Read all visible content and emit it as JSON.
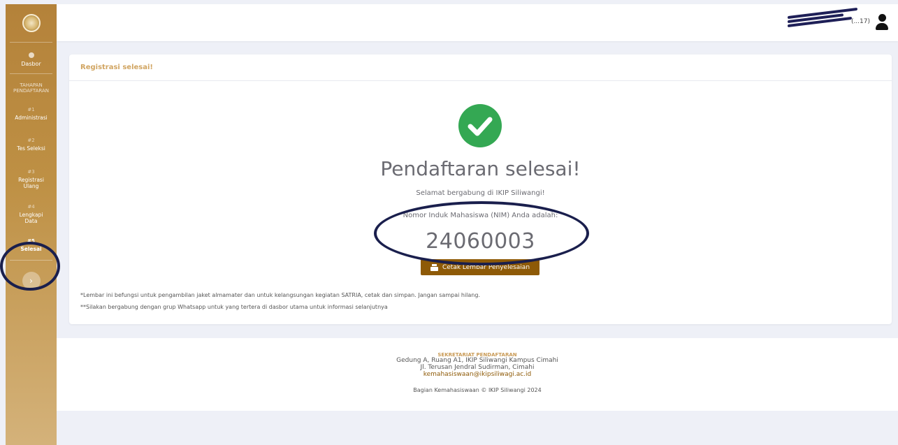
{
  "sidebar": {
    "home_label": "Dasbor",
    "section_heading": "TAHAPAN PENDAFTARAN",
    "steps": [
      {
        "num": "#1",
        "label": "Administrasi"
      },
      {
        "num": "#2",
        "label": "Tes Seleksi"
      },
      {
        "num": "#3",
        "label": "Registrasi Ulang"
      },
      {
        "num": "#4",
        "label": "Lengkapi Data"
      },
      {
        "num": "#5",
        "label": "Selesai"
      }
    ],
    "toggle_glyph": "›"
  },
  "header": {
    "user_name": "(...17)"
  },
  "card": {
    "title": "Registrasi selesai!",
    "heading": "Pendaftaran selesai!",
    "welcome": "Selamat bergabung di IKIP Siliwangi!",
    "nim_label": "Nomor Induk Mahasiswa (NIM) Anda adalah:",
    "nim_value": "24060003",
    "print_button": "Cetak Lembar Penyelesaian",
    "note1": "*Lembar ini befungsi untuk pengambilan jaket almamater dan untuk kelangsungan kegiatan SATRIA, cetak dan simpan. Jangan sampai hilang.",
    "note2": "**Silakan bergabung dengan grup Whatsapp untuk yang tertera di dasbor utama untuk informasi selanjutnya"
  },
  "footer": {
    "heading": "SEKRETARIAT PENDAFTARAN",
    "address1": "Gedung A, Ruang A1, IKIP Siliwangi Kampus Cimahi",
    "address2": "Jl. Terusan Jendral Sudirman, Cimahi",
    "email": "kemahasiswaan@ikipsiliwagi.ac.id",
    "copyright": "Bagian Kemahasiswaan © IKIP Siliwangi 2024"
  },
  "colors": {
    "brand": "#b4823a",
    "accent_button": "#8e5a07",
    "success": "#34a853",
    "annotation": "#1a1f4d"
  }
}
